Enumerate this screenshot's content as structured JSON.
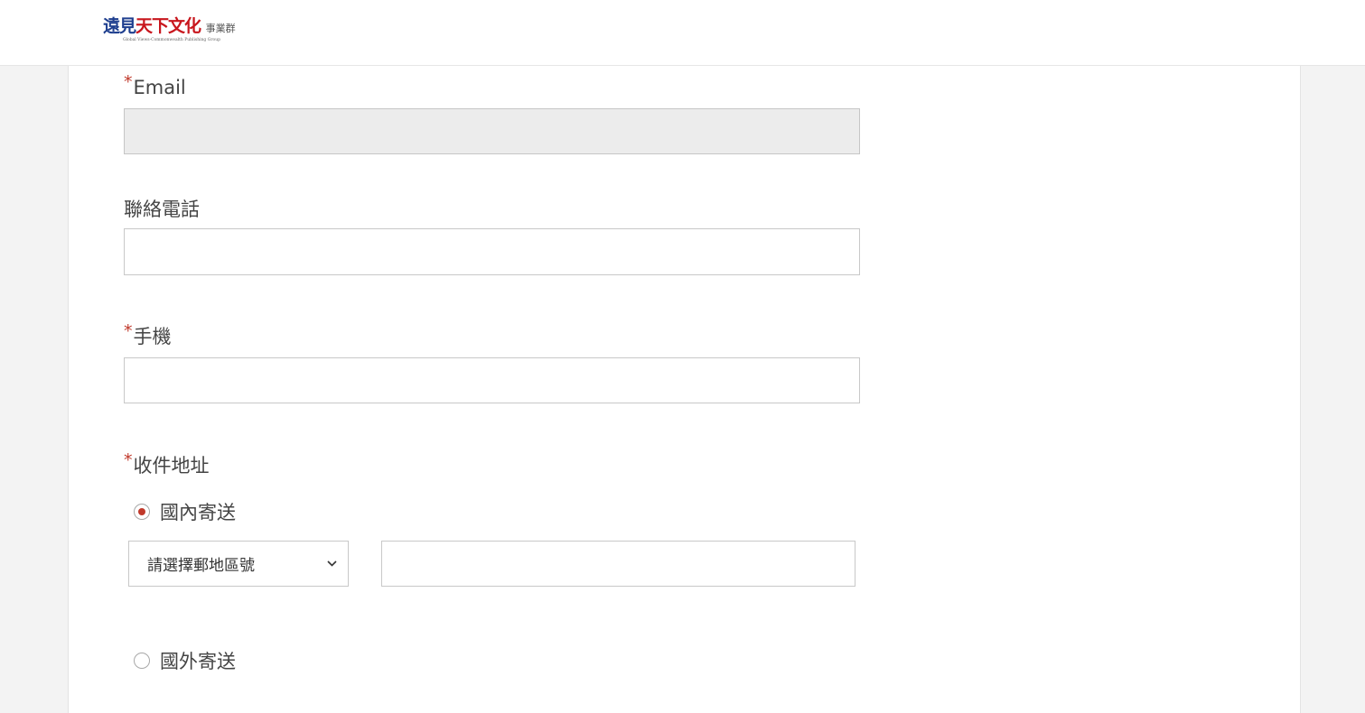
{
  "header": {
    "logo": {
      "part1": "遠見",
      "part2": "天下文化",
      "part3": "事業群",
      "subtitle": "Global Views-Commonwealth Publishing Group"
    }
  },
  "form": {
    "email": {
      "label": "Email",
      "required": true,
      "value": ""
    },
    "phone": {
      "label": "聯絡電話",
      "required": false,
      "value": ""
    },
    "mobile": {
      "label": "手機",
      "required": true,
      "value": ""
    },
    "address": {
      "label": "收件地址",
      "required": true,
      "options": {
        "domestic": {
          "label": "國內寄送",
          "checked": true
        },
        "overseas": {
          "label": "國外寄送",
          "checked": false
        }
      },
      "zip_select": {
        "selected": "請選擇郵地區號"
      },
      "address_value": ""
    },
    "required_mark": "*"
  },
  "colors": {
    "accent": "#c0392b",
    "logo_blue": "#1f3f8f",
    "logo_red": "#c8161d"
  }
}
